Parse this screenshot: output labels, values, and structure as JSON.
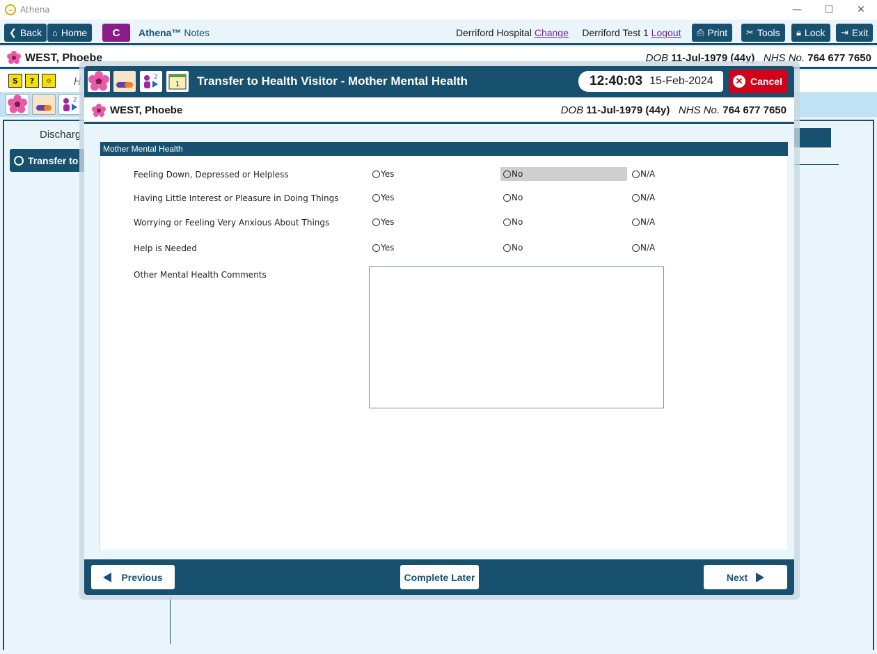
{
  "window": {
    "title": "Athena"
  },
  "toolbar": {
    "back_label": "Back",
    "home_label": "Home",
    "c_label": "C",
    "brand_name": "Athena™",
    "brand_suffix": "Notes",
    "hospital": "Derriford Hospital",
    "change_link": "Change",
    "user": "Derriford Test 1",
    "logout_link": "Logout",
    "print_label": "Print",
    "tools_label": "Tools",
    "lock_label": "Lock",
    "exit_label": "Exit"
  },
  "patient": {
    "name": "WEST, Phoebe",
    "dob_label": "DOB",
    "dob": "11-Jul-1979 (44y)",
    "nhs_label": "NHS No.",
    "nhs": "764 677 7650"
  },
  "background": {
    "h_label": "H",
    "discharge_label": "Discharg",
    "transfer_item": "Transfer to",
    "icon_badges": [
      "S",
      "?",
      "☼"
    ],
    "queue_count": "2"
  },
  "modal": {
    "title": "Transfer to Health Visitor - Mother Mental Health",
    "time": "12:40:03",
    "date": "15-Feb-2024",
    "cancel_label": "Cancel",
    "queue_count": "2",
    "notes_count": "1",
    "section_title": "Mother Mental Health",
    "questions": [
      {
        "label": "Feeling Down, Depressed or Helpless",
        "selected": "No"
      },
      {
        "label": "Having Little Interest or Pleasure in Doing Things",
        "selected": ""
      },
      {
        "label": "Worrying or Feeling Very Anxious About Things",
        "selected": ""
      },
      {
        "label": "Help is Needed",
        "selected": ""
      }
    ],
    "options": [
      "Yes",
      "No",
      "N/A"
    ],
    "comments_label": "Other Mental Health Comments",
    "comments_value": "",
    "previous_label": "Previous",
    "complete_later_label": "Complete Later",
    "next_label": "Next"
  },
  "colors": {
    "primary": "#17516f",
    "cancel": "#d0021b",
    "accent_c": "#8b1a8b",
    "background": "#e9f4fb"
  }
}
